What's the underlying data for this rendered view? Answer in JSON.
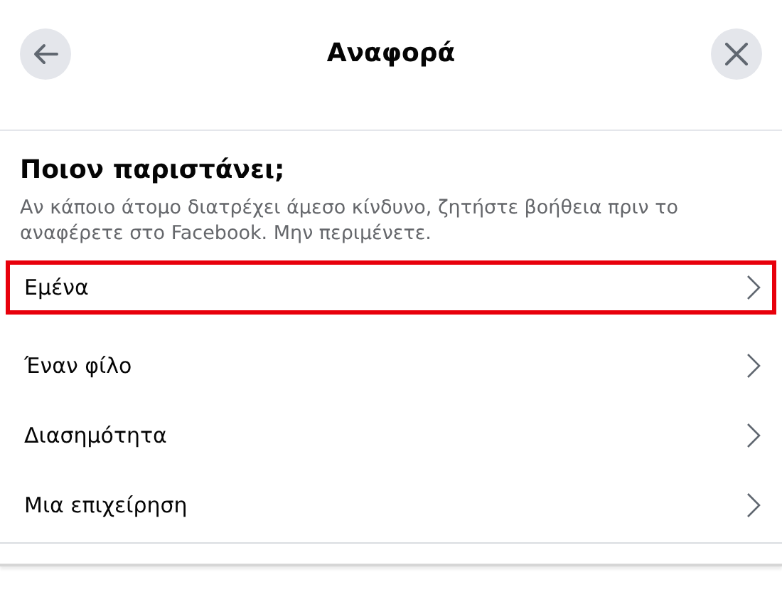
{
  "header": {
    "title": "Αναφορά"
  },
  "heading": "Ποιον παριστάνει;",
  "description": "Αν κάποιο άτομο διατρέχει άμεσο κίνδυνο, ζητήστε βοήθεια πριν το αναφέρετε στο Facebook. Μην περιμένετε.",
  "options": [
    {
      "label": "Εμένα",
      "highlighted": true
    },
    {
      "label": "Έναν φίλο",
      "highlighted": false
    },
    {
      "label": "Διασημότητα",
      "highlighted": false
    },
    {
      "label": "Μια επιχείρηση",
      "highlighted": false
    }
  ]
}
